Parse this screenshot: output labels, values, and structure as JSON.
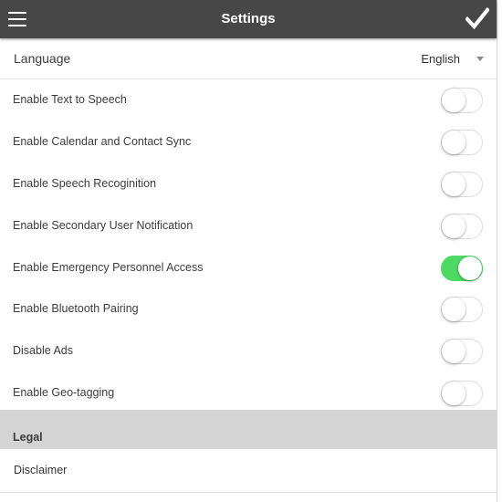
{
  "header": {
    "title": "Settings",
    "left_icon": "menu-icon",
    "right_icon": "check-icon"
  },
  "language": {
    "label": "Language",
    "value": "English"
  },
  "settings": [
    {
      "label": "Enable Text to Speech",
      "on": false
    },
    {
      "label": "Enable Calendar and Contact Sync",
      "on": false
    },
    {
      "label": "Enable Speech Recoginition",
      "on": false
    },
    {
      "label": "Enable Secondary User Notification",
      "on": false
    },
    {
      "label": "Enable Emergency Personnel Access",
      "on": true
    },
    {
      "label": "Enable Bluetooth Pairing",
      "on": false
    },
    {
      "label": "Disable Ads",
      "on": false
    },
    {
      "label": "Enable Geo-tagging",
      "on": false
    }
  ],
  "legal": {
    "section_title": "Legal",
    "items": [
      {
        "label": "Disclaimer"
      }
    ]
  },
  "colors": {
    "header_bg": "#474747",
    "toggle_on": "#4cd964",
    "section_bg": "#d4d4d4"
  }
}
